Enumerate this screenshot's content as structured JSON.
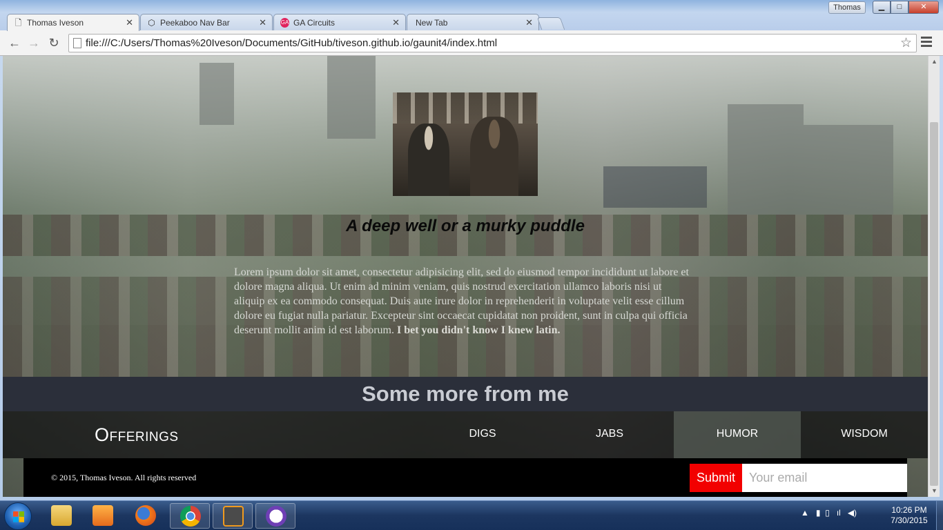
{
  "browser": {
    "user_badge": "Thomas",
    "tabs": [
      {
        "label": "Thomas Iveson",
        "icon": "page-icon"
      },
      {
        "label": "Peekaboo Nav Bar",
        "icon": "codepen-icon"
      },
      {
        "label": "GA Circuits",
        "icon": "ga-icon"
      },
      {
        "label": "New Tab",
        "icon": ""
      }
    ],
    "url": "file:///C:/Users/Thomas%20Iveson/Documents/GitHub/tiveson.github.io/gaunit4/index.html"
  },
  "page": {
    "hero_title": "A deep well or a murky puddle",
    "hero_body": "Lorem ipsum dolor sit amet, consectetur adipisicing elit, sed do eiusmod tempor incididunt ut labore et dolore magna aliqua. Ut enim ad minim veniam, quis nostrud exercitation ullamco laboris nisi ut aliquip ex ea commodo consequat. Duis aute irure dolor in reprehenderit in voluptate velit esse cillum dolore eu fugiat nulla pariatur. Excepteur sint occaecat cupidatat non proident, sunt in culpa qui officia deserunt mollit anim id est laborum.",
    "hero_body_bold": "I bet you didn't know I knew latin.",
    "more_title": "Some more from me",
    "offerings_title": "Offerings",
    "nav": [
      "DIGS",
      "JABS",
      "HUMOR",
      "WISDOM"
    ],
    "copyright": "© 2015, Thomas Iveson. All rights reserved",
    "submit_label": "Submit",
    "email_placeholder": "Your email"
  },
  "taskbar": {
    "time": "10:26 PM",
    "date": "7/30/2015"
  },
  "colors": {
    "footer_bg": "#000000",
    "submit_bg": "#f20000",
    "more_bar_bg": "#2b2f3a"
  }
}
